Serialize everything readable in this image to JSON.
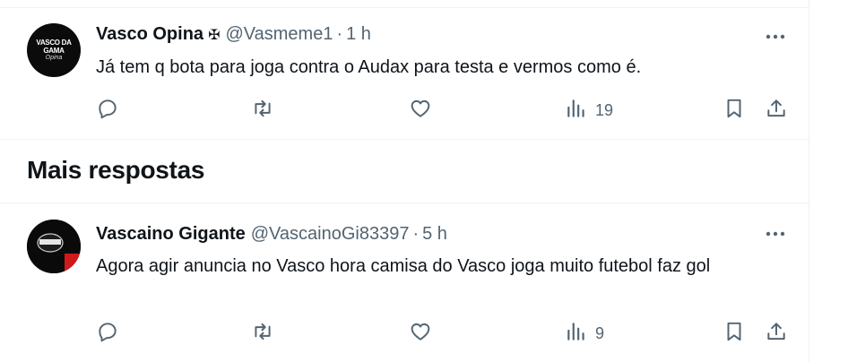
{
  "section_title": "Mais respostas",
  "tweets": [
    {
      "author_name": "Vasco Opina",
      "badge": "✠",
      "handle": "@Vasmeme1",
      "separator": "·",
      "time": "1 h",
      "text": "Já tem q bota para joga contra o Audax para testa e vermos como é.",
      "views": "19",
      "avatar_text": "VASCO DA\nGAMA",
      "avatar_sub": "Opina"
    },
    {
      "author_name": "Vascaino Gigante",
      "handle": "@VascainoGi83397",
      "separator": "·",
      "time": "5 h",
      "text": "Agora agir anuncia no Vasco hora camisa do Vasco joga muito futebol faz gol",
      "views": "9"
    }
  ],
  "icons": {
    "more": "more-options-icon",
    "reply": "reply-icon",
    "retweet": "retweet-icon",
    "like": "like-icon",
    "views": "views-icon",
    "bookmark": "bookmark-icon",
    "share": "share-icon"
  },
  "colors": {
    "text": "#0f1419",
    "secondary": "#536471",
    "divider": "#eff3f4"
  }
}
